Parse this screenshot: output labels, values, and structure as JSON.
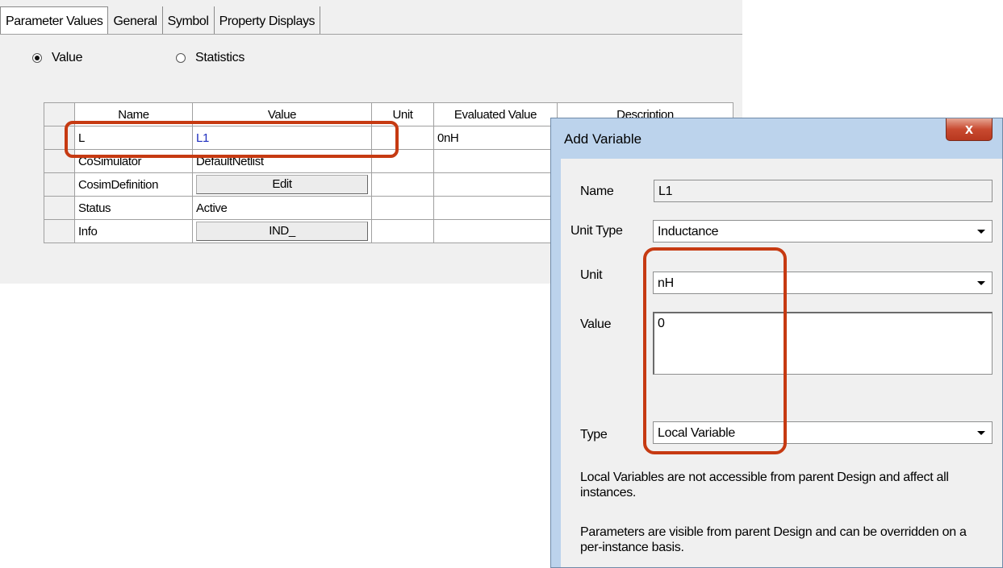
{
  "tabs": [
    "Parameter Values",
    "General",
    "Symbol",
    "Property Displays"
  ],
  "radio": {
    "value_label": "Value",
    "statistics_label": "Statistics",
    "selected": "Value"
  },
  "grid": {
    "columns": [
      "Name",
      "Value",
      "Unit",
      "Evaluated Value",
      "Description"
    ],
    "rows": [
      {
        "name": "L",
        "value": "L1",
        "unit": "",
        "evaluated": "0nH",
        "description": ""
      },
      {
        "name": "CoSimulator",
        "value": "DefaultNetlist",
        "unit": "",
        "evaluated": "",
        "description": ""
      },
      {
        "name": "CosimDefinition",
        "value": "Edit",
        "unit": "",
        "evaluated": "",
        "description": ""
      },
      {
        "name": "Status",
        "value": "Active",
        "unit": "",
        "evaluated": "",
        "description": ""
      },
      {
        "name": "Info",
        "value": "IND_",
        "unit": "",
        "evaluated": "",
        "description": ""
      }
    ]
  },
  "dialog": {
    "title": "Add Variable",
    "close_glyph": "x",
    "name_label": "Name",
    "name_value": "L1",
    "unit_type_label": "Unit Type",
    "unit_type_value": "Inductance",
    "unit_label": "Unit",
    "unit_value": "nH",
    "value_label": "Value",
    "value_value": "0",
    "type_label": "Type",
    "type_value": "Local Variable",
    "info_1": "Local Variables are not accessible from parent Design and affect all instances.",
    "info_2": "Parameters are visible from parent Design and can be overridden on a per-instance basis."
  },
  "colors": {
    "highlight": "#c63a12",
    "link_value": "#1f2fbf",
    "title_bar": "#bcd3ec"
  }
}
